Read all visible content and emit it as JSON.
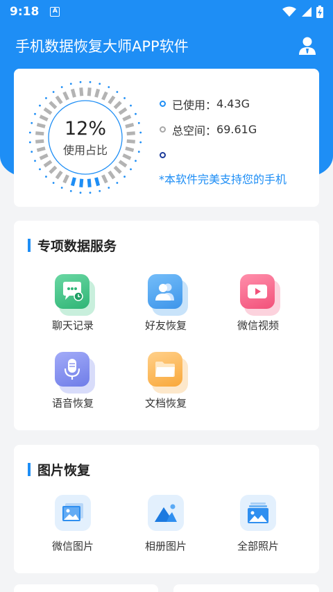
{
  "status_bar": {
    "time": "9:18",
    "app_indicator": "A"
  },
  "header": {
    "title": "手机数据恢复大师APP软件",
    "user_icon": "user-icon"
  },
  "usage": {
    "percent_text": "12%",
    "percent_value": 12,
    "caption": "使用占比",
    "used_label": "已使用：",
    "used_value": "4.43G",
    "total_label": "总空间：",
    "total_value": "69.61G",
    "promo": "*本软件完美支持您的手机"
  },
  "services": {
    "title": "专项数据服务",
    "items": [
      {
        "label": "聊天记录",
        "icon": "chat-icon"
      },
      {
        "label": "好友恢复",
        "icon": "contacts-icon"
      },
      {
        "label": "微信视频",
        "icon": "video-icon"
      },
      {
        "label": "语音恢复",
        "icon": "microphone-icon"
      },
      {
        "label": "文档恢复",
        "icon": "folder-icon"
      }
    ]
  },
  "photos": {
    "title": "图片恢复",
    "items": [
      {
        "label": "微信图片",
        "icon": "image-icon"
      },
      {
        "label": "相册图片",
        "icon": "mountain-icon"
      },
      {
        "label": "全部照片",
        "icon": "photos-icon"
      }
    ]
  },
  "colors": {
    "brand": "#1e8ef5",
    "used_dot": "#1e8ef5",
    "total_dot": "#a6a6a6",
    "third_dot": "#1b3a99"
  }
}
